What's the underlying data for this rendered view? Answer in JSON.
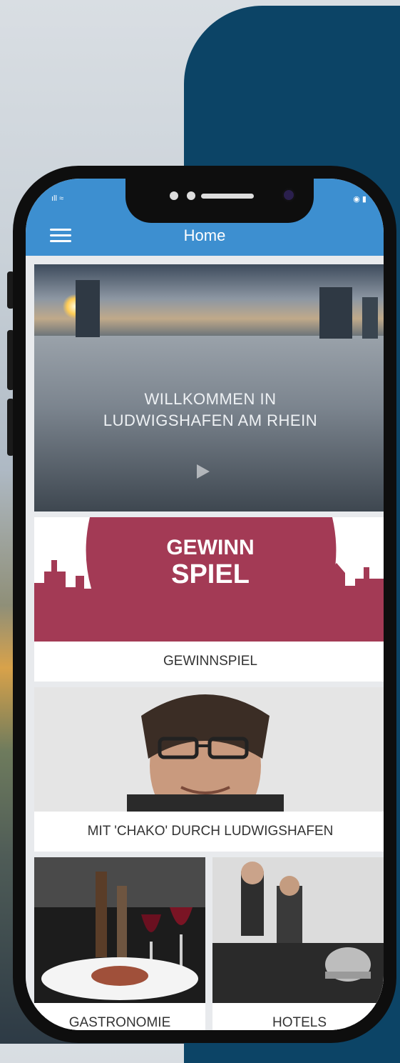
{
  "app": {
    "title": "Home"
  },
  "status_bar": {
    "left_text": "ıll ≈",
    "right_text": "◉ ▮"
  },
  "tiles": {
    "hero": {
      "line1": "WILLKOMMEN IN",
      "line2": "LUDWIGSHAFEN AM RHEIN"
    },
    "gewinnspiel": {
      "logo_line1": "GEWINN",
      "logo_line2": "SPIEL",
      "label": "GEWINNSPIEL"
    },
    "chako": {
      "label": "MIT 'CHAKO' DURCH LUDWIGSHAFEN"
    },
    "gastronomie": {
      "label": "GASTRONOMIE"
    },
    "hotels": {
      "label": "HOTELS"
    }
  },
  "colors": {
    "accent": "#3d8fd0",
    "backdrop": "#0c4466",
    "gewinn_red": "#a33a55"
  },
  "icons": [
    "menu-icon",
    "play-icon",
    "signal-icon",
    "battery-icon",
    "camera-icon"
  ]
}
